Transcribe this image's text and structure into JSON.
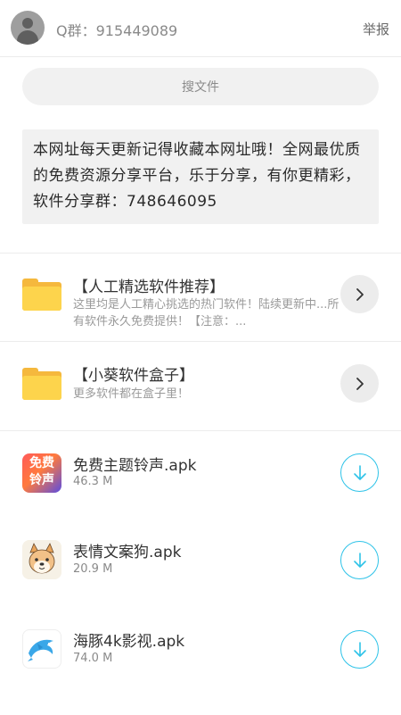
{
  "header": {
    "group_label": "Q群：915449089",
    "report_label": "举报"
  },
  "search": {
    "label": "搜文件"
  },
  "notice": {
    "text": "本网址每天更新记得收藏本网址哦！全网最优质的免费资源分享平台，乐于分享，有你更精彩，软件分享群：748646095"
  },
  "folders": [
    {
      "title": "【人工精选软件推荐】",
      "description": "这里均是人工精心挑选的热门软件！陆续更新中...所有软件永久免费提供！【注意：..."
    },
    {
      "title": "【小葵软件盒子】",
      "description": "更多软件都在盒子里！"
    }
  ],
  "files": [
    {
      "name": "免费主题铃声.apk",
      "size": "46.3 M",
      "icon_text": [
        "免费",
        "铃声"
      ]
    },
    {
      "name": "表情文案狗.apk",
      "size": "20.9 M"
    },
    {
      "name": "海豚4k影视.apk",
      "size": "74.0 M"
    }
  ],
  "colors": {
    "accent": "#2ec3e8",
    "folder": "#fdd44c",
    "ringtone_icon_start": "#ff5a5a",
    "ringtone_icon_end": "#5b4de0"
  },
  "icons": {
    "avatar": "user-avatar-icon",
    "folder": "folder-icon",
    "chevron": "chevron-right-icon",
    "download": "download-icon"
  }
}
